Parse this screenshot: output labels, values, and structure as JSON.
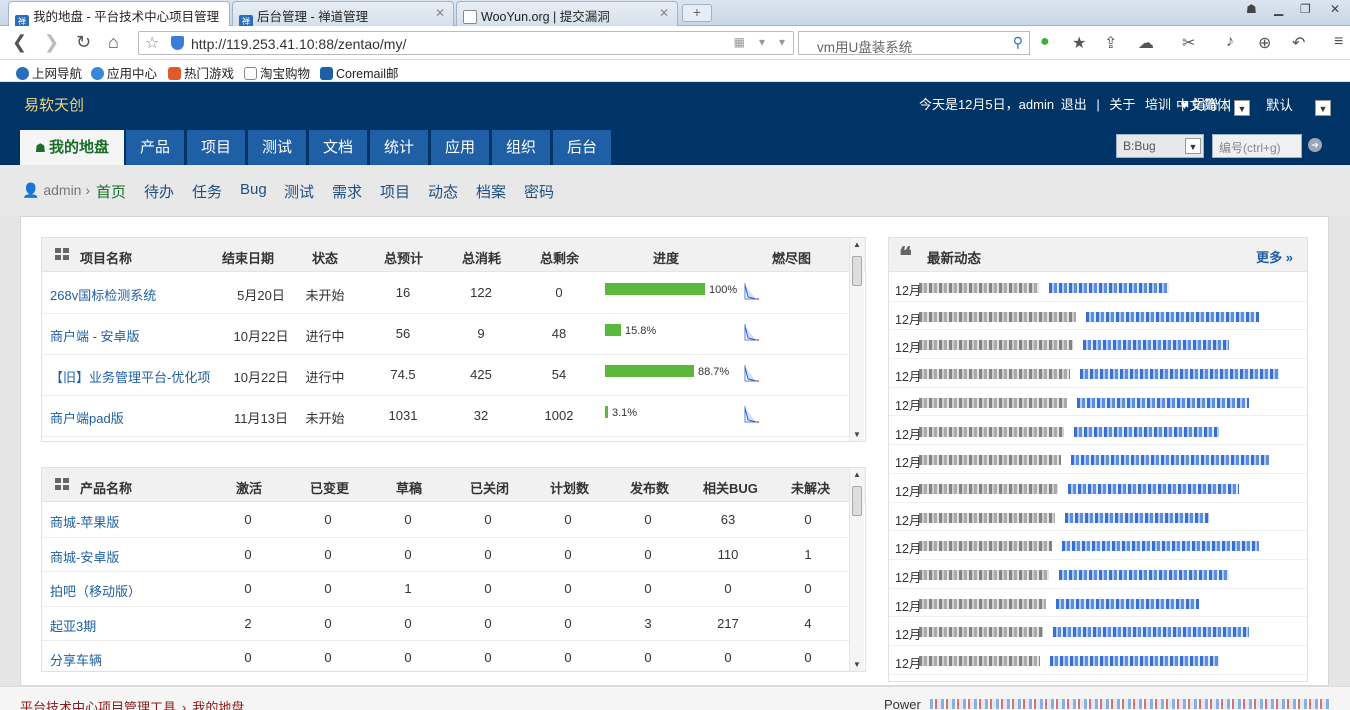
{
  "browser": {
    "tabs": [
      {
        "title": "我的地盘 - 平台技术中心项目管理",
        "active": true
      },
      {
        "title": "后台管理 - 禅道管理",
        "active": false
      },
      {
        "title": "WooYun.org | 提交漏洞",
        "active": false
      }
    ],
    "url": "http://119.253.41.10:88/zentao/my/",
    "search_placeholder": "vm用U盘装系统",
    "bookmarks": [
      "上网导航",
      "应用中心",
      "热门游戏",
      "淘宝购物",
      "Coremail邮"
    ]
  },
  "header": {
    "brand": "易软天创",
    "date_text": "今天是12月5日，",
    "user": "admin",
    "logout": "退出",
    "sep": "|",
    "about": "关于",
    "training": "培训",
    "donate": "♥ 捐赠",
    "language": "中文简体",
    "theme": "默认",
    "nav": [
      "我的地盘",
      "产品",
      "项目",
      "测试",
      "文档",
      "统计",
      "应用",
      "组织",
      "后台"
    ],
    "search_type": "B:Bug",
    "id_placeholder": "编号(ctrl+g)"
  },
  "subnav": {
    "user": "admin",
    "items": [
      "首页",
      "待办",
      "任务",
      "Bug",
      "测试",
      "需求",
      "项目",
      "动态",
      "档案",
      "密码"
    ]
  },
  "projects": {
    "headers": [
      "项目名称",
      "结束日期",
      "状态",
      "总预计",
      "总消耗",
      "总剩余",
      "进度",
      "燃尽图"
    ],
    "rows": [
      {
        "name": "268v国标检测系统",
        "end": "5月20日",
        "status": "未开始",
        "estimate": "16",
        "consumed": "122",
        "left": "0",
        "progress": 100,
        "progress_text": "100%"
      },
      {
        "name": "商户端 - 安卓版",
        "end": "10月22日",
        "status": "进行中",
        "estimate": "56",
        "consumed": "9",
        "left": "48",
        "progress": 15.8,
        "progress_text": "15.8%"
      },
      {
        "name": "【旧】业务管理平台-优化项",
        "end": "10月22日",
        "status": "进行中",
        "estimate": "74.5",
        "consumed": "425",
        "left": "54",
        "progress": 88.7,
        "progress_text": "88.7%"
      },
      {
        "name": "商户端pad版",
        "end": "11月13日",
        "status": "未开始",
        "estimate": "1031",
        "consumed": "32",
        "left": "1002",
        "progress": 3.1,
        "progress_text": "3.1%"
      }
    ]
  },
  "products": {
    "headers": [
      "产品名称",
      "激活",
      "已变更",
      "草稿",
      "已关闭",
      "计划数",
      "发布数",
      "相关BUG",
      "未解决"
    ],
    "rows": [
      {
        "name": "商城-苹果版",
        "vals": [
          "0",
          "0",
          "0",
          "0",
          "0",
          "0",
          "63",
          "0"
        ]
      },
      {
        "name": "商城-安卓版",
        "vals": [
          "0",
          "0",
          "0",
          "0",
          "0",
          "0",
          "110",
          "1"
        ]
      },
      {
        "name": "拍吧（移动版）",
        "vals": [
          "0",
          "0",
          "1",
          "0",
          "0",
          "0",
          "0",
          "0"
        ]
      },
      {
        "name": "起亚3期",
        "vals": [
          "2",
          "0",
          "0",
          "0",
          "0",
          "3",
          "217",
          "4"
        ]
      },
      {
        "name": "分享车辆",
        "vals": [
          "0",
          "0",
          "0",
          "0",
          "0",
          "0",
          "0",
          "0"
        ]
      }
    ]
  },
  "feed": {
    "title": "最新动态",
    "more": "更多",
    "dates": [
      "12月",
      "12月",
      "12月",
      "12月",
      "12月",
      "12月",
      "12月",
      "12月",
      "12月",
      "12月",
      "12月",
      "12月",
      "12月",
      "12月"
    ]
  },
  "footer": {
    "crumb1": "平台技术中心项目管理工具",
    "crumb2": "我的地盘",
    "power": "Power"
  },
  "colors": {
    "header_bg": "#003366",
    "nav_bg": "#1f5fa5",
    "progress": "#5cb83c",
    "link": "#1f5fa5"
  }
}
